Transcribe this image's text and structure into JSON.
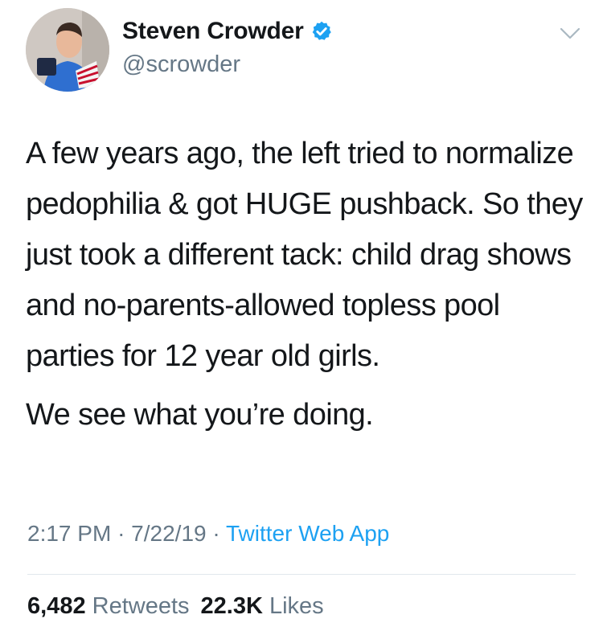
{
  "author": {
    "display_name": "Steven Crowder",
    "handle": "@scrowder",
    "avatar_icon": "profile-photo-avatar",
    "verified_icon": "verified-badge-icon",
    "verified_color": "#1da1f2"
  },
  "menu_icon": "chevron-down-icon",
  "tweet": {
    "paragraphs": [
      "A few years ago, the left tried to normalize pedophilia & got HUGE pushback. So they just took a different tack: child drag shows and no-parents-allowed topless pool parties for 12 year old girls.",
      "We see what you’re doing."
    ]
  },
  "meta": {
    "time": "2:17 PM",
    "separator": "·",
    "date": "7/22/19",
    "source": "Twitter Web App"
  },
  "stats": {
    "retweets_count": "6,482",
    "retweets_label": "Retweets",
    "likes_count": "22.3K",
    "likes_label": "Likes"
  },
  "colors": {
    "text": "#14171a",
    "secondary": "#657786",
    "link": "#1da1f2",
    "divider": "#e1e8ed"
  }
}
